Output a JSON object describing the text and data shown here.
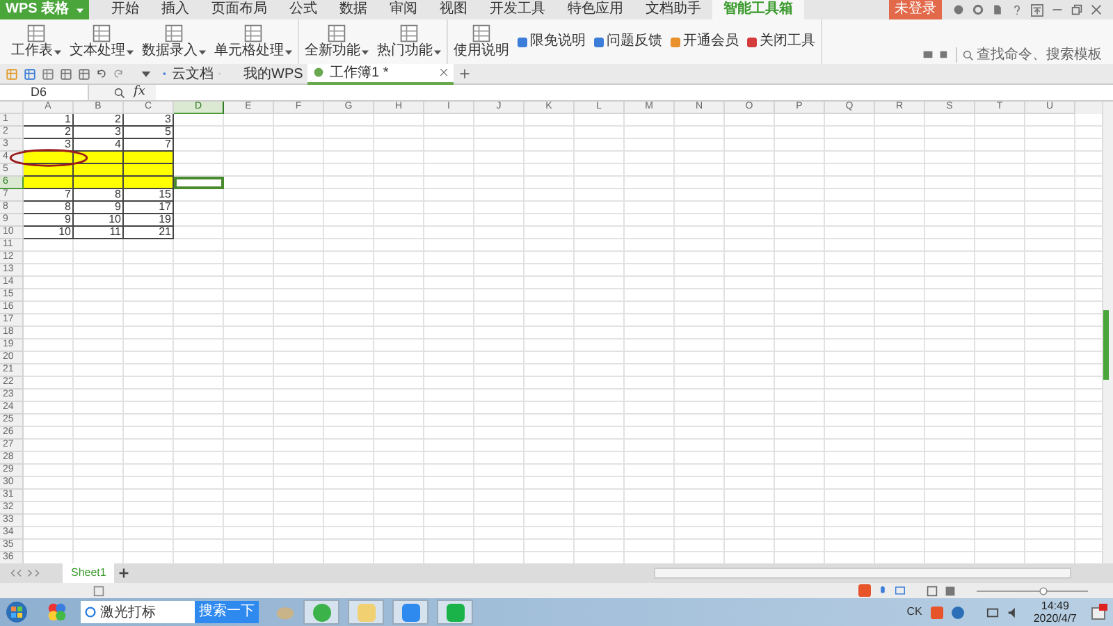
{
  "app": {
    "name": "WPS 表格"
  },
  "menu_tabs": [
    {
      "label": "开始",
      "selected": false
    },
    {
      "label": "插入",
      "selected": false
    },
    {
      "label": "页面布局",
      "selected": false
    },
    {
      "label": "公式",
      "selected": false
    },
    {
      "label": "数据",
      "selected": false
    },
    {
      "label": "审阅",
      "selected": false
    },
    {
      "label": "视图",
      "selected": false
    },
    {
      "label": "开发工具",
      "selected": false
    },
    {
      "label": "特色应用",
      "selected": false
    },
    {
      "label": "文档助手",
      "selected": false
    },
    {
      "label": "智能工具箱",
      "selected": true
    }
  ],
  "login_button": "未登录",
  "ribbon_groups": [
    {
      "items": [
        {
          "kind": "large",
          "label": "工作表",
          "dropdown": true
        },
        {
          "kind": "large",
          "label": "文本处理",
          "dropdown": true
        },
        {
          "kind": "large",
          "label": "数据录入",
          "dropdown": true
        },
        {
          "kind": "large",
          "label": "单元格处理",
          "dropdown": true
        }
      ]
    },
    {
      "items": [
        {
          "kind": "large",
          "label": "全新功能",
          "dropdown": true
        },
        {
          "kind": "large",
          "label": "热门功能",
          "dropdown": true
        }
      ]
    },
    {
      "items": [
        {
          "kind": "large",
          "label": "使用说明",
          "dropdown": false
        },
        {
          "kind": "small",
          "label": "限免说明",
          "color": "#3b7dd8"
        },
        {
          "kind": "small",
          "label": "问题反馈",
          "color": "#3b7dd8"
        },
        {
          "kind": "small",
          "label": "开通会员",
          "color": "#e8912d"
        },
        {
          "kind": "small",
          "label": "关闭工具",
          "color": "#d43b3b"
        }
      ]
    }
  ],
  "command_search": {
    "placeholder": "查找命令、搜索模板"
  },
  "doc_tabs": [
    {
      "label": "云文档",
      "selected": false
    },
    {
      "label": "我的WPS",
      "selected": false
    },
    {
      "label": "工作簿1 *",
      "selected": true
    }
  ],
  "name_box": "D6",
  "fx": "fx",
  "columns": [
    {
      "label": "A",
      "selected": false
    },
    {
      "label": "B",
      "selected": false
    },
    {
      "label": "C",
      "selected": false
    },
    {
      "label": "D",
      "selected": true
    },
    {
      "label": "E",
      "selected": false
    },
    {
      "label": "F",
      "selected": false
    },
    {
      "label": "G",
      "selected": false
    },
    {
      "label": "H",
      "selected": false
    },
    {
      "label": "I",
      "selected": false
    },
    {
      "label": "J",
      "selected": false
    },
    {
      "label": "K",
      "selected": false
    },
    {
      "label": "L",
      "selected": false
    },
    {
      "label": "M",
      "selected": false
    },
    {
      "label": "N",
      "selected": false
    },
    {
      "label": "O",
      "selected": false
    },
    {
      "label": "P",
      "selected": false
    },
    {
      "label": "Q",
      "selected": false
    },
    {
      "label": "R",
      "selected": false
    },
    {
      "label": "S",
      "selected": false
    },
    {
      "label": "T",
      "selected": false
    },
    {
      "label": "U",
      "selected": false
    }
  ],
  "rows": [
    {
      "label": "1",
      "selected": false,
      "highlighted": false,
      "cells": [
        "1",
        "2",
        "3"
      ]
    },
    {
      "label": "2",
      "selected": false,
      "highlighted": false,
      "cells": [
        "2",
        "3",
        "5"
      ]
    },
    {
      "label": "3",
      "selected": false,
      "highlighted": false,
      "cells": [
        "3",
        "4",
        "7"
      ]
    },
    {
      "label": "4",
      "selected": false,
      "highlighted": true,
      "cells": []
    },
    {
      "label": "5",
      "selected": false,
      "highlighted": true,
      "cells": []
    },
    {
      "label": "6",
      "selected": true,
      "highlighted": true,
      "cells": []
    },
    {
      "label": "7",
      "selected": false,
      "highlighted": false,
      "cells": [
        "7",
        "8",
        "15"
      ]
    },
    {
      "label": "8",
      "selected": false,
      "highlighted": false,
      "cells": [
        "8",
        "9",
        "17"
      ]
    },
    {
      "label": "9",
      "selected": false,
      "highlighted": false,
      "cells": [
        "9",
        "10",
        "19"
      ]
    },
    {
      "label": "10",
      "selected": false,
      "highlighted": false,
      "cells": [
        "10",
        "11",
        "21"
      ]
    },
    {
      "label": "11",
      "selected": false,
      "highlighted": false,
      "cells": []
    },
    {
      "label": "12",
      "selected": false,
      "highlighted": false,
      "cells": []
    },
    {
      "label": "13",
      "selected": false,
      "highlighted": false,
      "cells": []
    },
    {
      "label": "14",
      "selected": false,
      "highlighted": false,
      "cells": []
    },
    {
      "label": "15",
      "selected": false,
      "highlighted": false,
      "cells": []
    },
    {
      "label": "16",
      "selected": false,
      "highlighted": false,
      "cells": []
    },
    {
      "label": "17",
      "selected": false,
      "highlighted": false,
      "cells": []
    },
    {
      "label": "18",
      "selected": false,
      "highlighted": false,
      "cells": []
    },
    {
      "label": "19",
      "selected": false,
      "highlighted": false,
      "cells": []
    },
    {
      "label": "20",
      "selected": false,
      "highlighted": false,
      "cells": []
    },
    {
      "label": "21",
      "selected": false,
      "highlighted": false,
      "cells": []
    },
    {
      "label": "22",
      "selected": false,
      "highlighted": false,
      "cells": []
    },
    {
      "label": "23",
      "selected": false,
      "highlighted": false,
      "cells": []
    },
    {
      "label": "24",
      "selected": false,
      "highlighted": false,
      "cells": []
    },
    {
      "label": "25",
      "selected": false,
      "highlighted": false,
      "cells": []
    },
    {
      "label": "26",
      "selected": false,
      "highlighted": false,
      "cells": []
    },
    {
      "label": "27",
      "selected": false,
      "highlighted": false,
      "cells": []
    },
    {
      "label": "28",
      "selected": false,
      "highlighted": false,
      "cells": []
    },
    {
      "label": "29",
      "selected": false,
      "highlighted": false,
      "cells": []
    },
    {
      "label": "30",
      "selected": false,
      "highlighted": false,
      "cells": []
    },
    {
      "label": "31",
      "selected": false,
      "highlighted": false,
      "cells": []
    },
    {
      "label": "32",
      "selected": false,
      "highlighted": false,
      "cells": []
    },
    {
      "label": "33",
      "selected": false,
      "highlighted": false,
      "cells": []
    },
    {
      "label": "34",
      "selected": false,
      "highlighted": false,
      "cells": []
    },
    {
      "label": "35",
      "selected": false,
      "highlighted": false,
      "cells": []
    },
    {
      "label": "36",
      "selected": false,
      "highlighted": false,
      "cells": []
    }
  ],
  "sheet_tabs": [
    {
      "label": "Sheet1",
      "selected": true
    }
  ],
  "taskbar": {
    "search": {
      "value": "激光打标",
      "button": "搜索一下"
    },
    "tray_text": "CK",
    "time": "14:49",
    "date": "2020/4/7"
  }
}
